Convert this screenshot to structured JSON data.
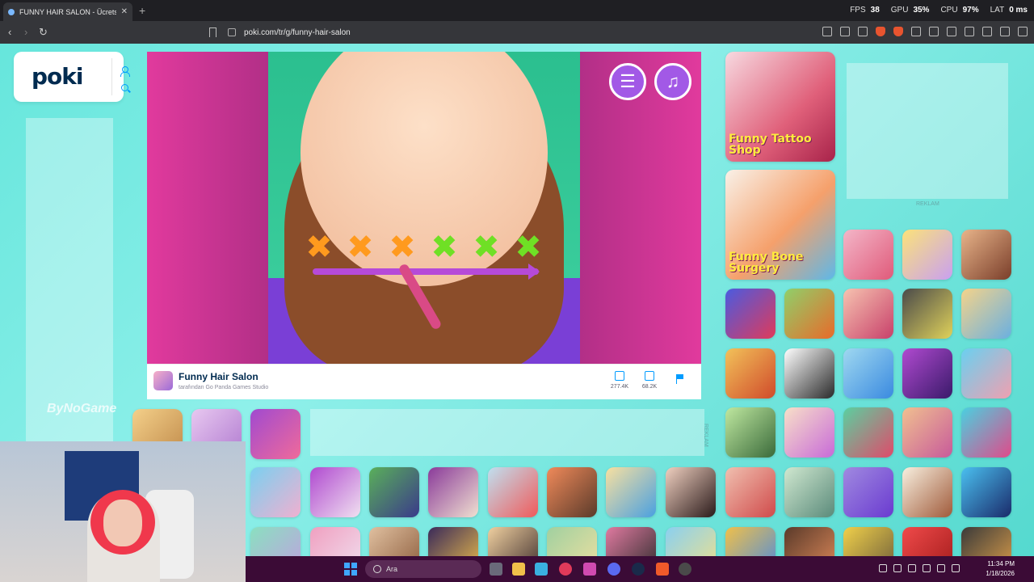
{
  "browser": {
    "tab_title": "FUNNY HAIR SALON - Ücretsi",
    "url": "poki.com/tr/g/funny-hair-salon",
    "perf": [
      {
        "label": "FPS",
        "value": "38"
      },
      {
        "label": "GPU",
        "value": "35%"
      },
      {
        "label": "CPU",
        "value": "97%"
      },
      {
        "label": "LAT",
        "value": "0 ms"
      }
    ]
  },
  "site": {
    "logo": "poki"
  },
  "game": {
    "title": "Funny Hair Salon",
    "studio": "tarafından Go Panda Games Studio",
    "likes": "277.4K",
    "dislikes": "68.2K",
    "marks": [
      {
        "symbol": "✖",
        "color": "orange"
      },
      {
        "symbol": "✖",
        "color": "orange"
      },
      {
        "symbol": "✖",
        "color": "orange"
      },
      {
        "symbol": "✖",
        "color": "green"
      },
      {
        "symbol": "✖",
        "color": "green"
      },
      {
        "symbol": "✖",
        "color": "green"
      }
    ],
    "menu_button": "☰",
    "music_button": "♫"
  },
  "ads": {
    "label": "REKLAM"
  },
  "tiles": {
    "big1_label": "Funny Tattoo Shop",
    "big2_label": "Funny Bone Surgery"
  },
  "overlay": {
    "watermark": "ByNoGame"
  },
  "taskbar": {
    "search_placeholder": "Ara",
    "time": "11:34 PM",
    "date": "1/18/2026"
  },
  "colors": {
    "brand": "#002b50",
    "accent": "#009cff",
    "bg": "#5fe0d8",
    "taskbar": "#3b0b36"
  }
}
